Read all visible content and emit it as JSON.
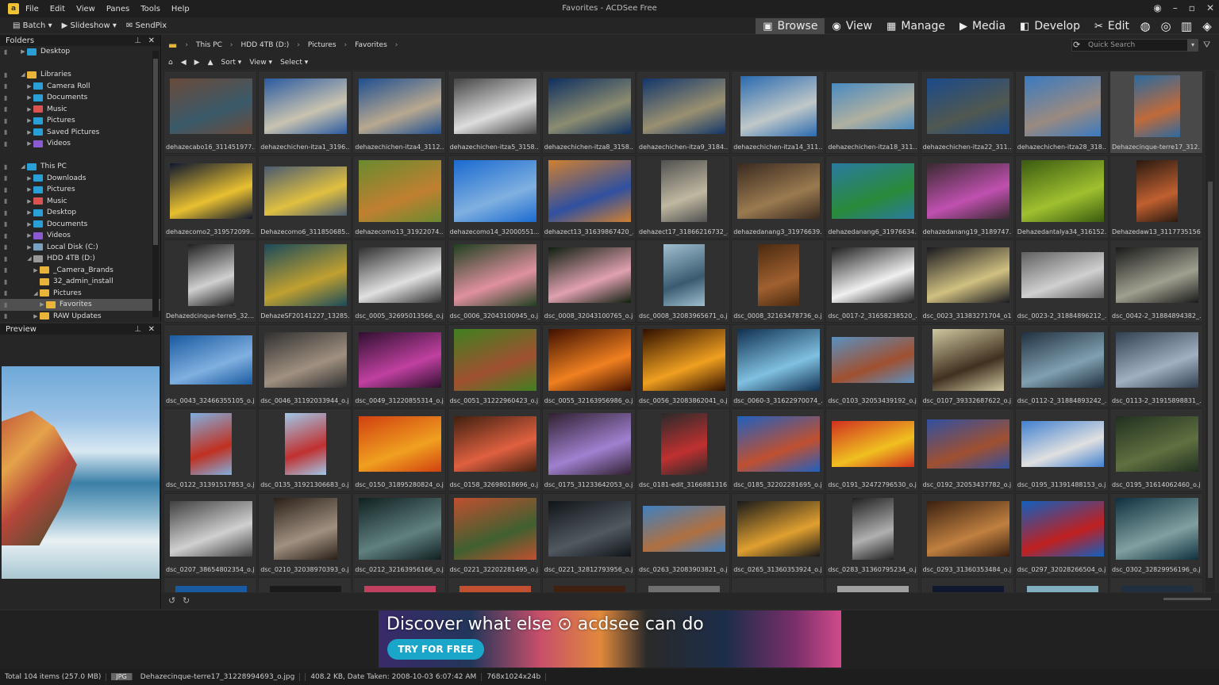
{
  "window": {
    "title": "Favorites - ACDSee Free",
    "app_icon": "acdsee-logo-icon"
  },
  "menu": [
    "File",
    "Edit",
    "View",
    "Panes",
    "Tools",
    "Help"
  ],
  "toolbar": {
    "batch": "Batch",
    "slideshow": "Slideshow",
    "sendpix": "SendPix"
  },
  "modes": [
    {
      "label": "Browse",
      "icon": "browse-icon",
      "active": true
    },
    {
      "label": "View",
      "icon": "eye-icon"
    },
    {
      "label": "Manage",
      "icon": "grid-icon"
    },
    {
      "label": "Media",
      "icon": "media-icon"
    },
    {
      "label": "Develop",
      "icon": "develop-icon"
    },
    {
      "label": "Edit",
      "icon": "edit-icon"
    }
  ],
  "folders": {
    "title": "Folders",
    "items": [
      {
        "label": "Desktop",
        "indent": 2,
        "color": "#2a9fd6",
        "toggle": "▶"
      },
      {
        "label": "",
        "indent": 0,
        "color": ""
      },
      {
        "label": "Libraries",
        "indent": 2,
        "color": "#e8b53a",
        "toggle": "◢"
      },
      {
        "label": "Camera Roll",
        "indent": 3,
        "color": "#2a9fd6",
        "toggle": "▶"
      },
      {
        "label": "Documents",
        "indent": 3,
        "color": "#2a9fd6",
        "toggle": "▶"
      },
      {
        "label": "Music",
        "indent": 3,
        "color": "#d9534f",
        "toggle": "▶"
      },
      {
        "label": "Pictures",
        "indent": 3,
        "color": "#2a9fd6",
        "toggle": "▶"
      },
      {
        "label": "Saved Pictures",
        "indent": 3,
        "color": "#2a9fd6",
        "toggle": "▶"
      },
      {
        "label": "Videos",
        "indent": 3,
        "color": "#8a5ad0",
        "toggle": "▶"
      },
      {
        "label": "",
        "indent": 0,
        "color": ""
      },
      {
        "label": "This PC",
        "indent": 2,
        "color": "#2a9fd6",
        "toggle": "◢"
      },
      {
        "label": "Downloads",
        "indent": 3,
        "color": "#2a9fd6",
        "toggle": "▶"
      },
      {
        "label": "Pictures",
        "indent": 3,
        "color": "#2a9fd6",
        "toggle": "▶"
      },
      {
        "label": "Music",
        "indent": 3,
        "color": "#d9534f",
        "toggle": "▶"
      },
      {
        "label": "Desktop",
        "indent": 3,
        "color": "#2a9fd6",
        "toggle": "▶"
      },
      {
        "label": "Documents",
        "indent": 3,
        "color": "#2a9fd6",
        "toggle": "▶"
      },
      {
        "label": "Videos",
        "indent": 3,
        "color": "#8a5ad0",
        "toggle": "▶"
      },
      {
        "label": "Local Disk (C:)",
        "indent": 3,
        "color": "#7aa0c0",
        "toggle": "▶"
      },
      {
        "label": "HDD 4TB (D:)",
        "indent": 3,
        "color": "#999999",
        "toggle": "◢"
      },
      {
        "label": "_Camera_Brands",
        "indent": 4,
        "color": "#e8b53a",
        "toggle": "▶"
      },
      {
        "label": "32_admin_install",
        "indent": 4,
        "color": "#e8b53a",
        "toggle": ""
      },
      {
        "label": "Pictures",
        "indent": 4,
        "color": "#e8b53a",
        "toggle": "◢"
      },
      {
        "label": "Favorites",
        "indent": 5,
        "color": "#e8b53a",
        "toggle": "▶",
        "selected": true
      },
      {
        "label": "RAW Updates",
        "indent": 4,
        "color": "#e8b53a",
        "toggle": "▶"
      }
    ]
  },
  "preview": {
    "title": "Preview"
  },
  "breadcrumb": [
    "This PC",
    "HDD 4TB (D:)",
    "Pictures",
    "Favorites"
  ],
  "search": {
    "placeholder": "Quick Search"
  },
  "nav": {
    "sort": "Sort",
    "view": "View",
    "select": "Select"
  },
  "thumbnails": [
    {
      "label": "dehazecabo16_311451977...",
      "c1": "#6a4a3a",
      "c2": "#3a5a6a",
      "w": 104,
      "h": 70
    },
    {
      "label": "dehazechichen-itza1_3196...",
      "c1": "#2a5aa0",
      "c2": "#c9c3b0",
      "w": 104,
      "h": 70
    },
    {
      "label": "dehazechichen-itza4_3112...",
      "c1": "#1f4f90",
      "c2": "#b8a890",
      "w": 104,
      "h": 70
    },
    {
      "label": "dehazechichen-itza5_3158...",
      "c1": "#444444",
      "c2": "#dddddd",
      "w": 104,
      "h": 70
    },
    {
      "label": "dehazechichen-itza8_3158...",
      "c1": "#0e2f5f",
      "c2": "#8c8c70",
      "w": 104,
      "h": 70
    },
    {
      "label": "dehazechichen-itza9_3184...",
      "c1": "#13366a",
      "c2": "#9a9070",
      "w": 104,
      "h": 70
    },
    {
      "label": "dehazechichen-itza14_311...",
      "c1": "#2a6ab0",
      "c2": "#c0c8c8",
      "w": 96,
      "h": 76
    },
    {
      "label": "dehazechichen-itza18_311...",
      "c1": "#4a8ac0",
      "c2": "#b0b0a0",
      "w": 104,
      "h": 58
    },
    {
      "label": "dehazechichen-itza22_311...",
      "c1": "#1b4a8a",
      "c2": "#505850",
      "w": 104,
      "h": 70
    },
    {
      "label": "dehazechichen-itza28_318...",
      "c1": "#3a7ac0",
      "c2": "#9a8a80",
      "w": 96,
      "h": 76
    },
    {
      "label": "Dehazecinque-terre17_312...",
      "c1": "#2a6aa0",
      "c2": "#c06a3a",
      "w": 58,
      "h": 78
    },
    {
      "label": "dehazecomo2_319572099...",
      "c1": "#101830",
      "c2": "#e8c030",
      "w": 104,
      "h": 70
    },
    {
      "label": "Dehazecomo6_311850685...",
      "c1": "#4a5a70",
      "c2": "#e0c040",
      "w": 104,
      "h": 62
    },
    {
      "label": "dehazecomo13_31922074...",
      "c1": "#6a8a30",
      "c2": "#c08030",
      "w": 104,
      "h": 78
    },
    {
      "label": "dehazecomo14_32000551...",
      "c1": "#1a6ad0",
      "c2": "#80b0e0",
      "w": 104,
      "h": 78
    },
    {
      "label": "dehazect13_31639867420_...",
      "c1": "#d08030",
      "c2": "#3050a0",
      "w": 104,
      "h": 78
    },
    {
      "label": "dehazect17_31866216732_...",
      "c1": "#505050",
      "c2": "#c0b8a0",
      "w": 58,
      "h": 78
    },
    {
      "label": "dehazedanang3_31976639...",
      "c1": "#3a2a20",
      "c2": "#9a7a50",
      "w": 104,
      "h": 70
    },
    {
      "label": "dehazedanang6_31976634...",
      "c1": "#2a7aa0",
      "c2": "#2a8a3a",
      "w": 104,
      "h": 70
    },
    {
      "label": "dehazedanang19_3189747...",
      "c1": "#3a2a30",
      "c2": "#c050b0",
      "w": 104,
      "h": 70
    },
    {
      "label": "Dehazedantalya34_316152...",
      "c1": "#3a5a10",
      "c2": "#a0c030",
      "w": 104,
      "h": 78
    },
    {
      "label": "Dehazedaw13_3117735156...",
      "c1": "#2a1a10",
      "c2": "#c06030",
      "w": 52,
      "h": 78
    },
    {
      "label": "Dehazedcinque-terre5_32...",
      "c1": "#202020",
      "c2": "#d0d0d0",
      "w": 58,
      "h": 78
    },
    {
      "label": "DehazeSF20141227_13285...",
      "c1": "#1a4a5a",
      "c2": "#c0a030",
      "w": 104,
      "h": 78
    },
    {
      "label": "dsc_0005_32695013566_o.j...",
      "c1": "#303030",
      "c2": "#e0e0e0",
      "w": 104,
      "h": 70
    },
    {
      "label": "dsc_0006_32043100945_o.j...",
      "c1": "#204020",
      "c2": "#e090a0",
      "w": 104,
      "h": 78
    },
    {
      "label": "dsc_0008_32043100765_o.j...",
      "c1": "#102010",
      "c2": "#e0a0b0",
      "w": 104,
      "h": 70
    },
    {
      "label": "dsc_0008_32083965671_o.j...",
      "c1": "#a0c0d0",
      "c2": "#3a5a70",
      "w": 52,
      "h": 78
    },
    {
      "label": "dsc_0008_32163478736_o.j...",
      "c1": "#4a2a10",
      "c2": "#a06030",
      "w": 52,
      "h": 78
    },
    {
      "label": "dsc_0017-2_31658238520_...",
      "c1": "#202020",
      "c2": "#f0f0f0",
      "w": 104,
      "h": 70
    },
    {
      "label": "dsc_0023_31383271704_o1...",
      "c1": "#1a1a20",
      "c2": "#d0c080",
      "w": 104,
      "h": 70
    },
    {
      "label": "dsc_0023-2_31884896212_...",
      "c1": "#606060",
      "c2": "#d0d0d0",
      "w": 104,
      "h": 58
    },
    {
      "label": "dsc_0042-2_31884894382_...",
      "c1": "#1a1a1a",
      "c2": "#a0a090",
      "w": 104,
      "h": 70
    },
    {
      "label": "dsc_0043_32466355105_o.j...",
      "c1": "#1a5aa0",
      "c2": "#80b0e0",
      "w": 104,
      "h": 62
    },
    {
      "label": "dsc_0046_31192033944_o.j...",
      "c1": "#303030",
      "c2": "#a09080",
      "w": 104,
      "h": 70
    },
    {
      "label": "dsc_0049_31220855314_o.j...",
      "c1": "#301030",
      "c2": "#c040a0",
      "w": 104,
      "h": 70
    },
    {
      "label": "dsc_0051_31222960423_o.j...",
      "c1": "#408020",
      "c2": "#a05030",
      "w": 104,
      "h": 78
    },
    {
      "label": "dsc_0055_32163956986_o.j...",
      "c1": "#401000",
      "c2": "#f08020",
      "w": 104,
      "h": 78
    },
    {
      "label": "dsc_0056_32083862041_o.j...",
      "c1": "#301000",
      "c2": "#f0a020",
      "w": 104,
      "h": 78
    },
    {
      "label": "dsc_0060-3_31622970074_...",
      "c1": "#103050",
      "c2": "#80c0e0",
      "w": 104,
      "h": 78
    },
    {
      "label": "dsc_0103_32053439192_o.j...",
      "c1": "#5a90c0",
      "c2": "#a05030",
      "w": 104,
      "h": 58
    },
    {
      "label": "dsc_0107_39332687622_o.j...",
      "c1": "#d0c8a0",
      "c2": "#403020",
      "w": 90,
      "h": 78
    },
    {
      "label": "dsc_0112-2_31884893242_...",
      "c1": "#203040",
      "c2": "#80a0b0",
      "w": 104,
      "h": 70
    },
    {
      "label": "dsc_0113-2_31915898831_...",
      "c1": "#304050",
      "c2": "#a0b0c0",
      "w": 104,
      "h": 70
    },
    {
      "label": "dsc_0122_31391517853_o.j...",
      "c1": "#80b0e0",
      "c2": "#c03020",
      "w": 52,
      "h": 78
    },
    {
      "label": "dsc_0135_31921306683_o.j...",
      "c1": "#a0c8e8",
      "c2": "#c03030",
      "w": 52,
      "h": 78
    },
    {
      "label": "dsc_0150_31895280824_o.j...",
      "c1": "#d04010",
      "c2": "#f0a020",
      "w": 104,
      "h": 70
    },
    {
      "label": "dsc_0158_32698018696_o.j...",
      "c1": "#402010",
      "c2": "#e06040",
      "w": 104,
      "h": 70
    },
    {
      "label": "dsc_0175_31233642053_o.j...",
      "c1": "#302030",
      "c2": "#a080d0",
      "w": 104,
      "h": 78
    },
    {
      "label": "dsc_0181-edit_3166881316...",
      "c1": "#2a2a2a",
      "c2": "#c03030",
      "w": 58,
      "h": 78
    },
    {
      "label": "dsc_0185_32202281695_o.j...",
      "c1": "#2060c0",
      "c2": "#c05030",
      "w": 104,
      "h": 70
    },
    {
      "label": "dsc_0191_32472796530_o.j...",
      "c1": "#d03020",
      "c2": "#f0c020",
      "w": 104,
      "h": 58
    },
    {
      "label": "dsc_0192_32053437782_o.j...",
      "c1": "#3050a0",
      "c2": "#a05030",
      "w": 104,
      "h": 62
    },
    {
      "label": "dsc_0195_31391488153_o.j...",
      "c1": "#4080d0",
      "c2": "#e0e0e0",
      "w": 104,
      "h": 58
    },
    {
      "label": "dsc_0195_31614062460_o.j...",
      "c1": "#203020",
      "c2": "#607040",
      "w": 104,
      "h": 70
    },
    {
      "label": "dsc_0207_38654802354_o.j...",
      "c1": "#404040",
      "c2": "#d0d0d0",
      "w": 104,
      "h": 70
    },
    {
      "label": "dsc_0210_32038970393_o.j...",
      "c1": "#2a2018",
      "c2": "#a09080",
      "w": 80,
      "h": 78
    },
    {
      "label": "dsc_0212_32163956166_o.j...",
      "c1": "#102020",
      "c2": "#608080",
      "w": 104,
      "h": 78
    },
    {
      "label": "dsc_0221_32202281495_o.j...",
      "c1": "#c05030",
      "c2": "#406030",
      "w": 104,
      "h": 78
    },
    {
      "label": "dsc_0221_32812793956_o.j...",
      "c1": "#101418",
      "c2": "#505860",
      "w": 104,
      "h": 70
    },
    {
      "label": "dsc_0263_32083903821_o.j...",
      "c1": "#4080c0",
      "c2": "#b07040",
      "w": 104,
      "h": 58
    },
    {
      "label": "dsc_0265_31360353924_o.j...",
      "c1": "#1a1a1a",
      "c2": "#e0a030",
      "w": 104,
      "h": 70
    },
    {
      "label": "dsc_0283_31360795234_o.j...",
      "c1": "#202020",
      "c2": "#b0b0b0",
      "w": 52,
      "h": 78
    },
    {
      "label": "dsc_0293_31360353484_o.j...",
      "c1": "#3a2010",
      "c2": "#c08040",
      "w": 104,
      "h": 70
    },
    {
      "label": "dsc_0297_32028266504_o.j...",
      "c1": "#1060c0",
      "c2": "#c02020",
      "w": 104,
      "h": 70
    },
    {
      "label": "dsc_0302_32829956196_o.j...",
      "c1": "#103040",
      "c2": "#80a0a0",
      "w": 104,
      "h": 78
    }
  ],
  "ad": {
    "headline": "Discover what else ⊙ acdsee can do",
    "button": "TRY FOR FREE"
  },
  "status": {
    "total": "Total 104 items  (257.0 MB)",
    "type": "JPG",
    "file": "Dehazecinque-terre17_31228994693_o.jpg",
    "info": "408.2 KB, Date Taken: 2008-10-03 6:07:42 AM",
    "dims": "768x1024x24b"
  }
}
